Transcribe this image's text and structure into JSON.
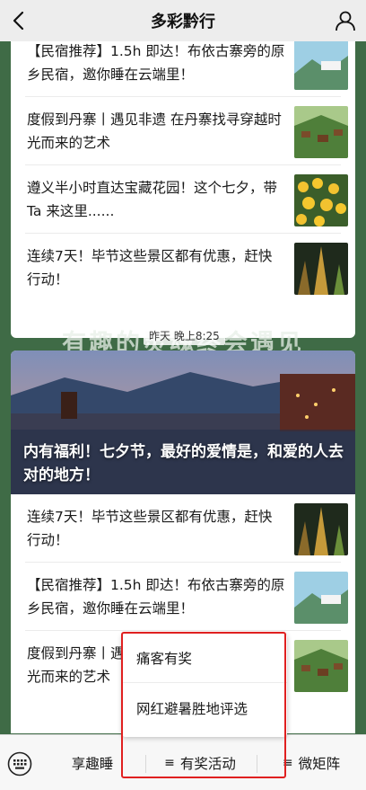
{
  "nav": {
    "title": "多彩黔行"
  },
  "card_top": {
    "articles": [
      {
        "title": "【民宿推荐】1.5h 即达！布依古寨旁的原乡民宿，邀你睡在云端里！",
        "thumb": "mountain-sky-thumb"
      },
      {
        "title": "度假到丹寨丨遇见非遗 在丹寨找寻穿越时光而来的艺术",
        "thumb": "village-hill-thumb"
      },
      {
        "title": "遵义半小时直达宝藏花园！这个七夕，带 Ta 来这里......",
        "thumb": "sunflower-field-thumb"
      },
      {
        "title": "连续7天！毕节这些景区都有优惠，赶快行动！",
        "thumb": "cave-lights-thumb"
      }
    ]
  },
  "banner": {
    "text": "有趣的灵魂终会遇见",
    "timestamp": "昨天 晚上8:25"
  },
  "card_bottom": {
    "hero_title": "内有福利！七夕节，最好的爱情是，和爱的人去对的地方！",
    "articles": [
      {
        "title": "连续7天！毕节这些景区都有优惠，赶快行动！",
        "thumb": "cave-lights-thumb"
      },
      {
        "title": "【民宿推荐】1.5h 即达！布依古寨旁的原乡民宿，邀你睡在云端里！",
        "thumb": "mountain-sky-thumb"
      },
      {
        "title": "度假到丹寨丨遇见非遗 在丹寨找寻穿越时光而来的艺术",
        "thumb": "village-hill-thumb"
      }
    ]
  },
  "bottom_menu": {
    "tabs": [
      {
        "label": "享趣睡"
      },
      {
        "label": "有奖活动"
      },
      {
        "label": "微矩阵"
      }
    ],
    "popup_items": [
      {
        "label": "痛客有奖"
      },
      {
        "label": "网红避暑胜地评选"
      }
    ]
  },
  "colors": {
    "page_bg": "#3f6b46",
    "nav_bg": "#ededed",
    "highlight": "#e02020"
  }
}
